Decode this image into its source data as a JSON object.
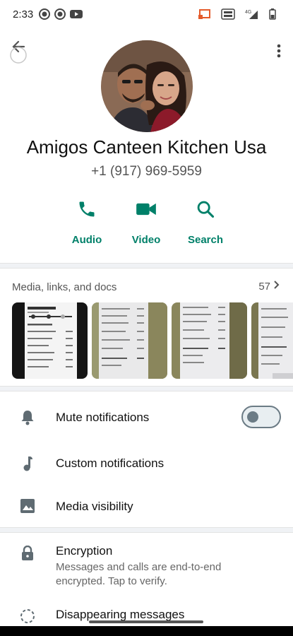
{
  "status_bar": {
    "time": "2:33",
    "network": "4G",
    "icons": [
      "whatsapp-dot-icon",
      "whatsapp-dot-icon",
      "youtube-icon",
      "cast-icon",
      "volte-icon",
      "signal-icon",
      "battery-icon"
    ]
  },
  "header": {
    "back_icon": "arrow-back-icon",
    "menu_icon": "more-vert-icon"
  },
  "contact": {
    "name": "Amigos Canteen Kitchen Usa",
    "phone": "+1 (917) 969-5959"
  },
  "actions": [
    {
      "label": "Audio",
      "icon": "phone-icon"
    },
    {
      "label": "Video",
      "icon": "videocam-icon"
    },
    {
      "label": "Search",
      "icon": "search-icon"
    }
  ],
  "media": {
    "title": "Media, links, and docs",
    "count": "57"
  },
  "settings": {
    "mute": {
      "label": "Mute notifications",
      "icon": "bell-icon",
      "enabled": false
    },
    "custom": {
      "label": "Custom notifications",
      "icon": "music-note-icon"
    },
    "visibility": {
      "label": "Media visibility",
      "icon": "image-icon"
    },
    "encryption": {
      "label": "Encryption",
      "subtitle": "Messages and calls are end-to-end encrypted. Tap to verify.",
      "icon": "lock-icon"
    },
    "disappearing": {
      "label": "Disappearing messages",
      "icon": "timer-icon"
    }
  },
  "colors": {
    "accent": "#008069",
    "icon_grey": "#5f6b72"
  }
}
